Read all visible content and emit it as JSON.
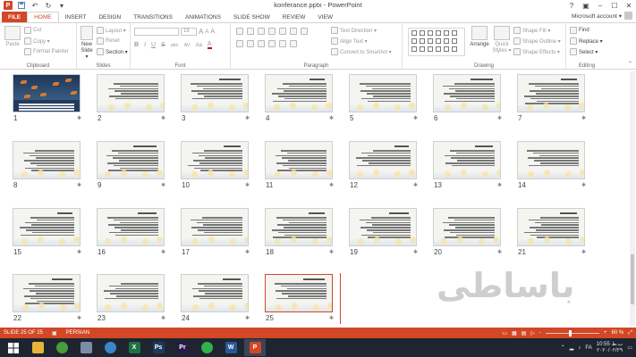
{
  "window": {
    "title": "konferance.pptx - PowerPoint",
    "controls": [
      "?",
      "restore-icon",
      "minimize-icon",
      "maximize-icon",
      "close-icon"
    ]
  },
  "qat": {
    "app_icon": "P",
    "save": "save-icon",
    "undo": "undo-icon",
    "redo": "redo-icon",
    "customize": "dropdown-icon"
  },
  "tabs": [
    "FILE",
    "HOME",
    "INSERT",
    "DESIGN",
    "TRANSITIONS",
    "ANIMATIONS",
    "SLIDE SHOW",
    "REVIEW",
    "VIEW"
  ],
  "active_tab": "HOME",
  "account": {
    "label": "Microsoft account ▾"
  },
  "ribbon": {
    "clipboard": {
      "label": "Clipboard",
      "paste": "Paste",
      "cut": "Cut",
      "copy": "Copy ▾",
      "format_painter": "Format Painter"
    },
    "slides": {
      "label": "Slides",
      "new_slide": "New",
      "new_slide2": "Slide ▾",
      "layout": "Layout ▾",
      "reset": "Reset",
      "section": "Section ▾"
    },
    "font": {
      "label": "Font",
      "size": "18",
      "bold": "B",
      "italic": "I",
      "underline": "U",
      "strike": "S",
      "shadow": "abc",
      "spacing": "AV",
      "case": "Aa",
      "grow": "A",
      "shrink": "A",
      "clear": "A",
      "highlight": "A"
    },
    "paragraph": {
      "label": "Paragraph",
      "text_direction": "Text Direction ▾",
      "align_text": "Align Text ▾",
      "smartart": "Convert to SmartArt ▾"
    },
    "drawing": {
      "label": "Drawing",
      "arrange": "Arrange",
      "quick_styles": "Quick",
      "quick_styles2": "Styles ▾",
      "shape_fill": "Shape Fill ▾",
      "shape_outline": "Shape Outline ▾",
      "shape_effects": "Shape Effects ▾"
    },
    "editing": {
      "label": "Editing",
      "find": "Find",
      "replace": "Replace ▾",
      "select": "Select ▾"
    }
  },
  "slides": [
    {
      "n": "1"
    },
    {
      "n": "2"
    },
    {
      "n": "3"
    },
    {
      "n": "4"
    },
    {
      "n": "5"
    },
    {
      "n": "6"
    },
    {
      "n": "7"
    },
    {
      "n": "8"
    },
    {
      "n": "9"
    },
    {
      "n": "10"
    },
    {
      "n": "11"
    },
    {
      "n": "12"
    },
    {
      "n": "13"
    },
    {
      "n": "14"
    },
    {
      "n": "15"
    },
    {
      "n": "16"
    },
    {
      "n": "17"
    },
    {
      "n": "18"
    },
    {
      "n": "19"
    },
    {
      "n": "20"
    },
    {
      "n": "21"
    },
    {
      "n": "22"
    },
    {
      "n": "23"
    },
    {
      "n": "24"
    },
    {
      "n": "25"
    }
  ],
  "slide_star": "✱",
  "watermark": "باساطی",
  "status": {
    "slide_info": "SLIDE 25 OF 25",
    "language": "PERSIAN",
    "zoom": "60 %",
    "zoom_minus": "-",
    "zoom_plus": "+"
  },
  "taskbar": {
    "apps": [
      {
        "name": "start-button",
        "label": "",
        "color": "#1f2530"
      },
      {
        "name": "file-explorer",
        "label": "",
        "color": "#e9b43a"
      },
      {
        "name": "chrome",
        "label": "",
        "color": "#4b9c3c"
      },
      {
        "name": "network-drive",
        "label": "",
        "color": "#7b8ca6"
      },
      {
        "name": "sync-app",
        "label": "",
        "color": "#3b86c8"
      },
      {
        "name": "excel",
        "label": "X",
        "color": "#1e7145"
      },
      {
        "name": "photoshop",
        "label": "Ps",
        "color": "#1c3c5e"
      },
      {
        "name": "premiere",
        "label": "Pr",
        "color": "#2a1a4a"
      },
      {
        "name": "whatsapp",
        "label": "",
        "color": "#2fb24c"
      },
      {
        "name": "word",
        "label": "W",
        "color": "#2b579a"
      },
      {
        "name": "powerpoint",
        "label": "P",
        "color": "#d24726"
      }
    ],
    "lang": "FA",
    "time": "10:55 ب.ظ",
    "date": "۲۰۲۰/۰۲/۲۹"
  }
}
